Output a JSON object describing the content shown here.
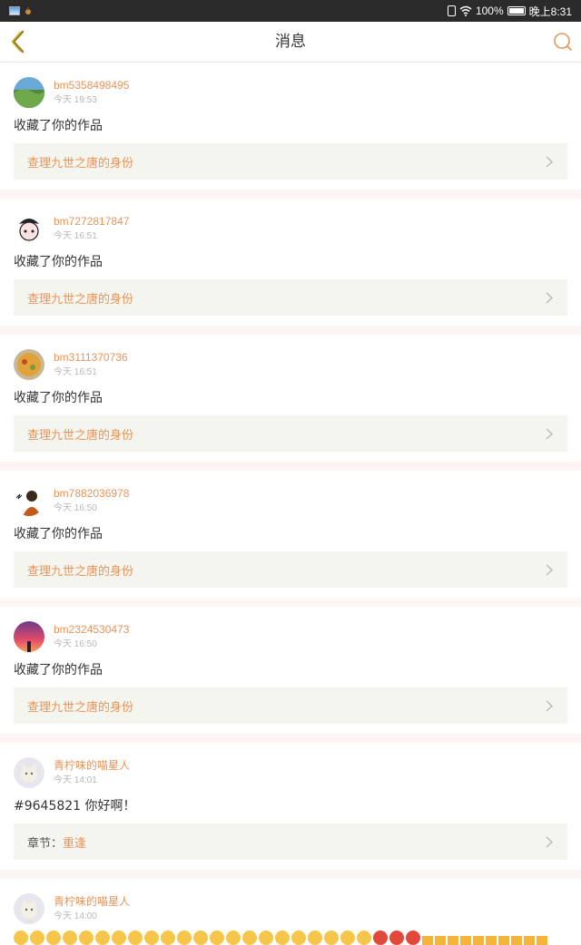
{
  "status_bar": {
    "battery": "100%",
    "time": "晚上8:31"
  },
  "navbar": {
    "title": "消息"
  },
  "colors": {
    "accent": "#e8945a",
    "card_divider": "#fdf4f4",
    "link_bg": "#f5f5ef"
  },
  "messages": [
    {
      "username": "bm5358498495",
      "time": "今天 19:53",
      "content": "收藏了你的作品",
      "link_text": "查理九世之唐的身份",
      "avatar_icon": "landscape-avatar"
    },
    {
      "username": "bm7272817847",
      "time": "今天 16:51",
      "content": "收藏了你的作品",
      "link_text": "查理九世之唐的身份",
      "avatar_icon": "cartoon-avatar"
    },
    {
      "username": "bm3111370736",
      "time": "今天 16:51",
      "content": "收藏了你的作品",
      "link_text": "查理九世之唐的身份",
      "avatar_icon": "food-avatar"
    },
    {
      "username": "bm7882036978",
      "time": "今天 16:50",
      "content": "收藏了你的作品",
      "link_text": "查理九世之唐的身份",
      "avatar_icon": "person-avatar"
    },
    {
      "username": "bm2324530473",
      "time": "今天 16:50",
      "content": "收藏了你的作品",
      "link_text": "查理九世之唐的身份",
      "avatar_icon": "sunset-avatar"
    },
    {
      "username": "青柠味的喵星人",
      "time": "今天 14:01",
      "content": "#9645821 你好啊！",
      "link_prefix": "章节：",
      "link_text": "重逢",
      "avatar_icon": "cat-avatar"
    },
    {
      "username": "青柠味的喵星人",
      "time": "今天 14:00",
      "avatar_icon": "cat-avatar"
    }
  ]
}
